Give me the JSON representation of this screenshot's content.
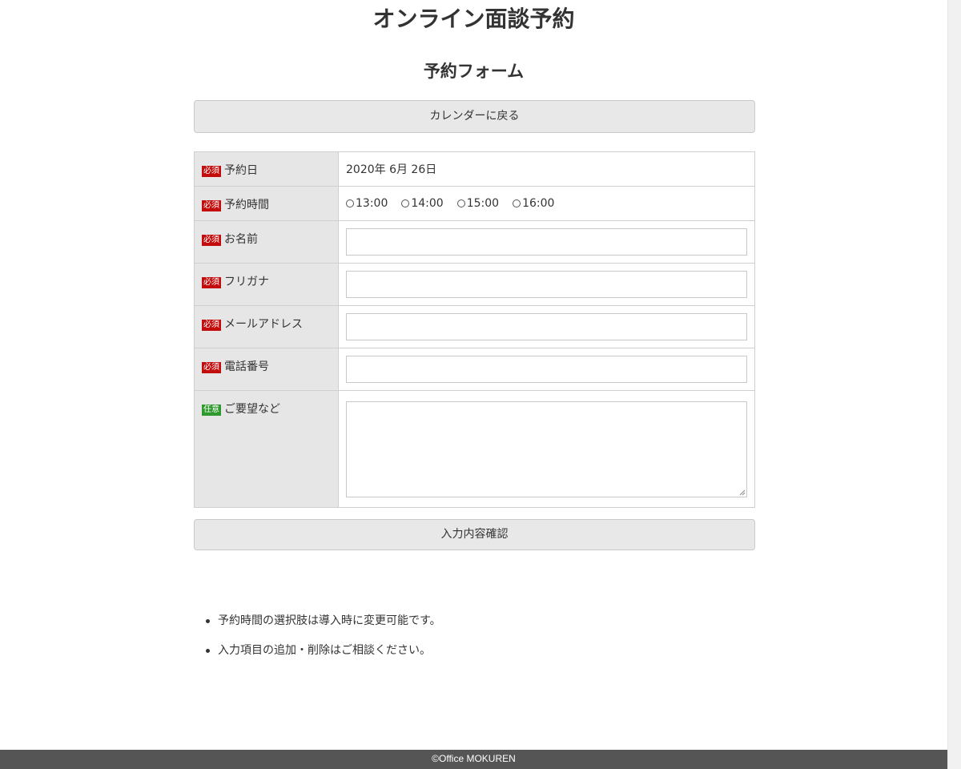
{
  "header": {
    "title": "オンライン面談予約",
    "form_title": "予約フォーム"
  },
  "buttons": {
    "back_label": "カレンダーに戻る",
    "confirm_label": "入力内容確認"
  },
  "badges": {
    "required": "必須",
    "optional": "任意"
  },
  "form": {
    "date": {
      "label": "予約日",
      "value": "2020年 6月 26日"
    },
    "time": {
      "label": "予約時間",
      "options": [
        "13:00",
        "14:00",
        "15:00",
        "16:00"
      ],
      "selected": null
    },
    "name": {
      "label": "お名前",
      "value": ""
    },
    "furigana": {
      "label": "フリガナ",
      "value": ""
    },
    "email": {
      "label": "メールアドレス",
      "value": ""
    },
    "phone": {
      "label": "電話番号",
      "value": ""
    },
    "requests": {
      "label": "ご要望など",
      "value": ""
    }
  },
  "notes": [
    "予約時間の選択肢は導入時に変更可能です。",
    "入力項目の追加・削除はご相談ください。"
  ],
  "footer": {
    "copyright": "©Office MOKUREN"
  },
  "colors": {
    "required_badge": "#c30d0d",
    "optional_badge": "#2e9a2e",
    "label_bg": "#e6e6e6",
    "button_bg": "#e8e8e8",
    "footer_bg": "#555555"
  }
}
